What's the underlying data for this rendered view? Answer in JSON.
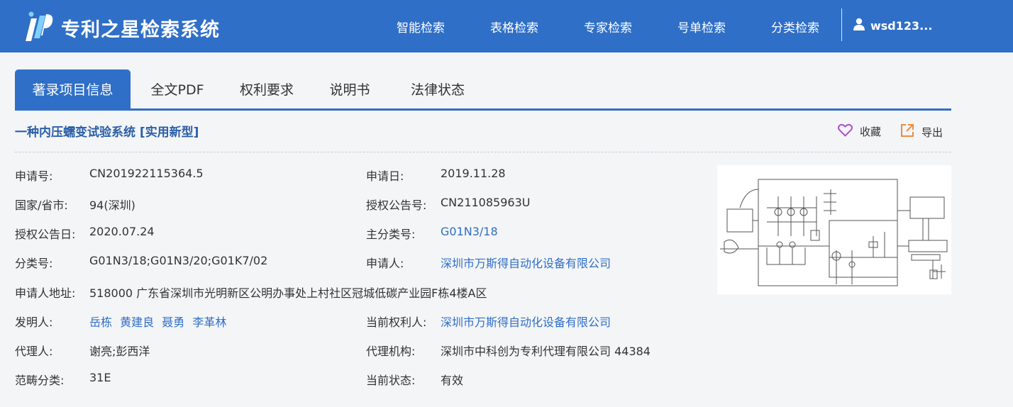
{
  "header": {
    "app_title": "专利之星检索系统",
    "nav": [
      "智能检索",
      "表格检索",
      "专家检索",
      "号单检索",
      "分类检索"
    ],
    "username": "wsd123...",
    "logo_icon": "patent-star-logo-icon",
    "user_icon": "user-icon"
  },
  "tabs": [
    "著录项目信息",
    "全文PDF",
    "权利要求",
    "说明书",
    "法律状态"
  ],
  "active_tab": 0,
  "patent": {
    "title": "一种内压蠕变试验系统 [实用新型]",
    "favorite_label": "收藏",
    "export_label": "导出",
    "favorite_icon": "heart-icon",
    "export_icon": "export-icon"
  },
  "fields": {
    "app_no_label": "申请号:",
    "app_no": "CN201922115364.5",
    "app_date_label": "申请日:",
    "app_date": "2019.11.28",
    "country_label": "国家/省市:",
    "country": "94(深圳)",
    "pub_no_label": "授权公告号:",
    "pub_no": "CN211085963U",
    "pub_date_label": "授权公告日:",
    "pub_date": "2020.07.24",
    "main_class_label": "主分类号:",
    "main_class": "G01N3/18",
    "class_label": "分类号:",
    "class": "G01N3/18;G01N3/20;G01K7/02",
    "applicant_label": "申请人:",
    "applicant": "深圳市万斯得自动化设备有限公司",
    "address_label": "申请人地址:",
    "address": "518000 广东省深圳市光明新区公明办事处上村社区冠城低碳产业园F栋4楼A区",
    "inventor_label": "发明人:",
    "inventors": [
      "岳栋",
      "黄建良",
      "聂勇",
      "李革林"
    ],
    "holder_label": "当前权利人:",
    "holder": "深圳市万斯得自动化设备有限公司",
    "agent_label": "代理人:",
    "agent": "谢亮;彭西洋",
    "agency_label": "代理机构:",
    "agency": "深圳市中科创为专利代理有限公司 44384",
    "category_label": "范畴分类:",
    "category": "31E",
    "status_label": "当前状态:",
    "status": "有效"
  },
  "colors": {
    "brand": "#2f6fc7",
    "link": "#2f6fc7",
    "favorite": "#b04fd0",
    "export": "#f08a3c"
  }
}
